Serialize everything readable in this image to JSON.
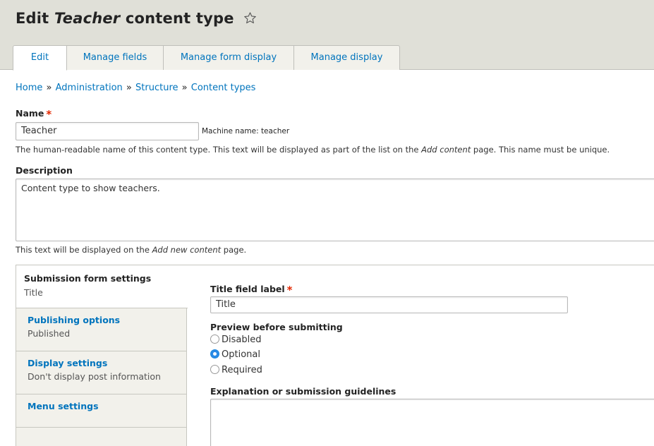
{
  "header": {
    "title_prefix": "Edit ",
    "title_type": "Teacher",
    "title_suffix": " content type",
    "star_icon": "star-outline-icon"
  },
  "tabs": [
    {
      "label": "Edit",
      "active": true
    },
    {
      "label": "Manage fields",
      "active": false
    },
    {
      "label": "Manage form display",
      "active": false
    },
    {
      "label": "Manage display",
      "active": false
    }
  ],
  "breadcrumb": {
    "items": [
      "Home",
      "Administration",
      "Structure",
      "Content types"
    ],
    "separator": "»"
  },
  "name_field": {
    "label": "Name",
    "required_mark": "*",
    "value": "Teacher",
    "machine_name": "Machine name: teacher",
    "help_before": "The human-readable name of this content type. This text will be displayed as part of the list on the ",
    "help_em": "Add content",
    "help_after": " page. This name must be unique."
  },
  "description_field": {
    "label": "Description",
    "value": "Content type to show teachers.",
    "help_before": "This text will be displayed on the ",
    "help_em": "Add new content",
    "help_after": " page."
  },
  "vertical_tabs": [
    {
      "title": "Submission form settings",
      "summary": "Title",
      "active": true
    },
    {
      "title": "Publishing options",
      "summary": "Published",
      "active": false
    },
    {
      "title": "Display settings",
      "summary": "Don't display post information",
      "active": false
    },
    {
      "title": "Menu settings",
      "summary": "",
      "active": false
    }
  ],
  "submission": {
    "title_label": "Title field label",
    "required_mark": "*",
    "title_value": "Title",
    "preview_label": "Preview before submitting",
    "preview_options": [
      {
        "label": "Disabled",
        "checked": false
      },
      {
        "label": "Optional",
        "checked": true
      },
      {
        "label": "Required",
        "checked": false
      }
    ],
    "guidelines_label": "Explanation or submission guidelines"
  },
  "colors": {
    "link": "#0074bd",
    "required": "#e32700",
    "header_bg": "#e0e0d8",
    "radio_active": "#2a8ae5"
  }
}
